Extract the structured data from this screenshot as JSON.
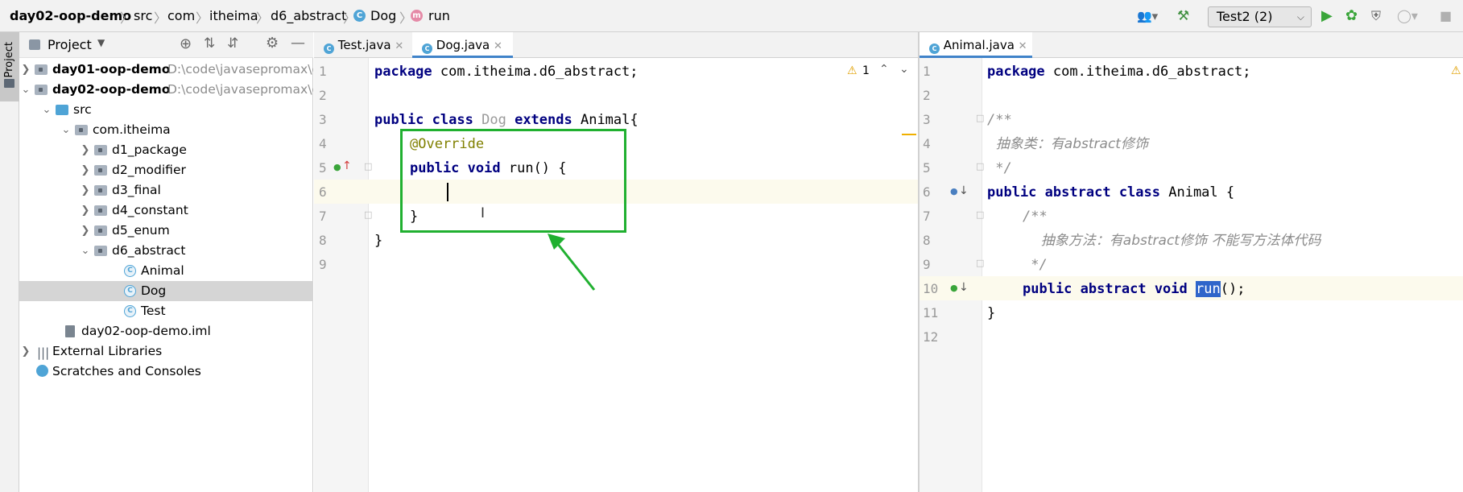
{
  "navbar": {
    "crumbs": [
      "day02-oop-demo",
      "src",
      "com",
      "itheima",
      "d6_abstract",
      "Dog",
      "run"
    ],
    "run_config": "Test2 (2)"
  },
  "tool_strip": {
    "project_label": "Project"
  },
  "project_panel": {
    "title": "Project",
    "tree": [
      {
        "label": "day01-oop-demo",
        "path": "D:\\code\\javasepromax\\c"
      },
      {
        "label": "day02-oop-demo",
        "path": "D:\\code\\javasepromax\\c"
      },
      {
        "label": "src"
      },
      {
        "label": "com.itheima"
      },
      {
        "label": "d1_package"
      },
      {
        "label": "d2_modifier"
      },
      {
        "label": "d3_final"
      },
      {
        "label": "d4_constant"
      },
      {
        "label": "d5_enum"
      },
      {
        "label": "d6_abstract"
      },
      {
        "label": "Animal"
      },
      {
        "label": "Dog"
      },
      {
        "label": "Test"
      },
      {
        "label": "day02-oop-demo.iml"
      },
      {
        "label": "External Libraries"
      },
      {
        "label": "Scratches and Consoles"
      }
    ]
  },
  "left_editor": {
    "tabs": [
      "Test.java",
      "Dog.java"
    ],
    "active_tab": "Dog.java",
    "warning_count": "1",
    "line_numbers": [
      "1",
      "2",
      "3",
      "4",
      "5",
      "6",
      "7",
      "8",
      "9"
    ],
    "lines": {
      "l1_kw": "package",
      "l1_rest": " com.itheima.d6_abstract;",
      "l3_kw1": "public",
      "l3_kw2": "class",
      "l3_name": "Dog",
      "l3_kw3": "extends",
      "l3_rest": " Animal{",
      "l4_anno": "@Override",
      "l5_kw1": "public",
      "l5_kw2": "void",
      "l5_rest": " run() {",
      "l7": "}",
      "l8": "}"
    }
  },
  "right_editor": {
    "tabs": [
      "Animal.java"
    ],
    "active_tab": "Animal.java",
    "line_numbers": [
      "1",
      "2",
      "3",
      "4",
      "5",
      "6",
      "7",
      "8",
      "9",
      "10",
      "11",
      "12"
    ],
    "lines": {
      "l1_kw": "package",
      "l1_rest": " com.itheima.d6_abstract;",
      "l3": "/**",
      "l4": "  抽象类：有abstract修饰",
      "l5": " */",
      "l6_kw1": "public",
      "l6_kw2": "abstract",
      "l6_kw3": "class",
      "l6_rest": " Animal {",
      "l7": "/**",
      "l8": "  抽象方法：有abstract修饰 不能写方法体代码",
      "l9": " */",
      "l10_kw1": "public",
      "l10_kw2": "abstract",
      "l10_kw3": "void",
      "l10_sel": "run",
      "l10_rest": "();",
      "l11": "}"
    }
  },
  "colors": {
    "keyword": "#000080",
    "annotation": "#808000",
    "comment": "#8c8c8c",
    "highlight_box": "#20b030",
    "selection": "#2f65ca"
  }
}
